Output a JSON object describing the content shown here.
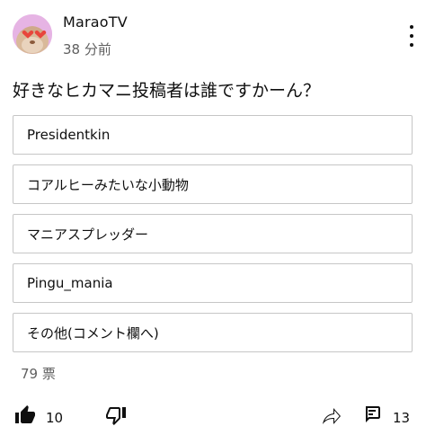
{
  "post": {
    "author": "MaraoTV",
    "time": "38 分前",
    "question": "好きなヒカマニ投稿者は誰ですかーん？"
  },
  "poll": {
    "options": [
      "Presidentkin",
      "コアルヒーみたいな小動物",
      "マニアスプレッダー",
      "Pingu_mania",
      "その他(コメント欄へ)"
    ],
    "votes": "79 票"
  },
  "actions": {
    "like_count": "10",
    "comment_count": "13"
  },
  "icons": {
    "menu": "more-vert-icon",
    "like": "thumbs-up-icon",
    "dislike": "thumbs-down-icon",
    "share": "share-icon",
    "comment": "comment-icon"
  }
}
